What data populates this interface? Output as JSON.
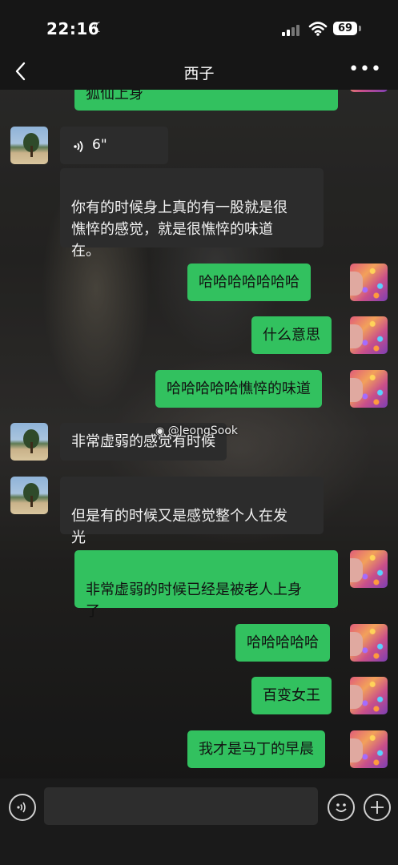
{
  "status_bar": {
    "time": "22:16",
    "battery": "69"
  },
  "nav": {
    "title": "西子"
  },
  "messages": [
    {
      "side": "me",
      "text": "狐仙上身"
    },
    {
      "side": "other",
      "duration": "6\""
    },
    {
      "side": "other",
      "text": "你有的时候身上真的有一股就是很\n憔悴的感觉，就是很憔悴的味道\n在。"
    },
    {
      "side": "me",
      "text": "哈哈哈哈哈哈哈"
    },
    {
      "side": "me",
      "text": "什么意思"
    },
    {
      "side": "me",
      "text": "哈哈哈哈哈憔悴的味道"
    },
    {
      "side": "other",
      "text": "非常虚弱的感觉有时候"
    },
    {
      "side": "other",
      "text": "但是有的时候又是感觉整个人在发\n光"
    },
    {
      "side": "me",
      "text": "非常虚弱的时候已经是被老人上身\n了"
    },
    {
      "side": "me",
      "text": "哈哈哈哈哈"
    },
    {
      "side": "me",
      "text": "百变女王"
    },
    {
      "side": "me",
      "text": "我才是马丁的早晨"
    }
  ],
  "watermark": "@JeongSook",
  "colors": {
    "my_bubble": "#32c15f",
    "other_bubble": "#2c2c2c",
    "bar": "#161616"
  },
  "icons": [
    "back-arrow-icon",
    "more-icon",
    "voice-icon",
    "emoji-icon",
    "plus-icon",
    "moon-icon",
    "wifi-icon",
    "signal-icon"
  ]
}
